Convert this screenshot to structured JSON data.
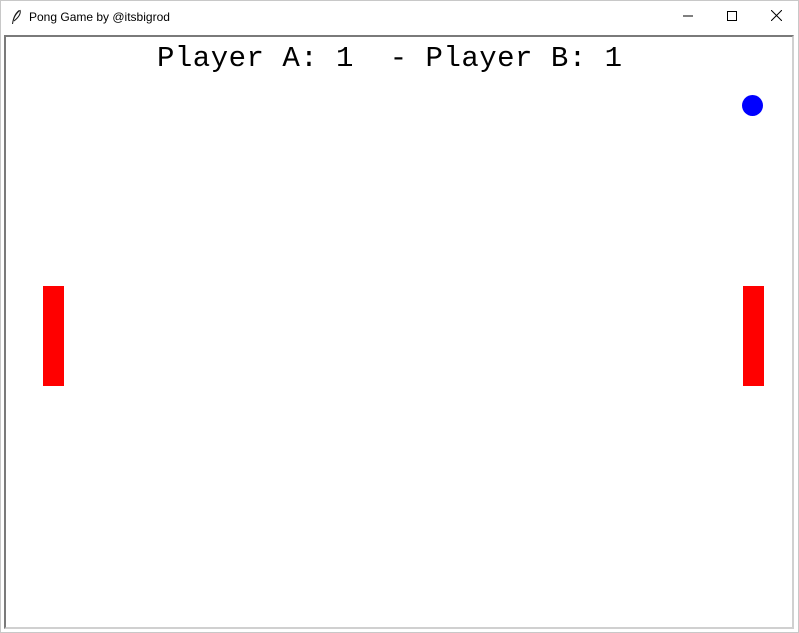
{
  "window": {
    "title": "Pong Game by @itsbigrod",
    "icon": "feather-icon"
  },
  "controls": {
    "minimize_icon": "minimize-icon",
    "maximize_icon": "maximize-icon",
    "close_icon": "close-icon"
  },
  "game": {
    "score_text": "Player A: 1  - Player B: 1",
    "player_a_score": 1,
    "player_b_score": 1,
    "colors": {
      "background": "#ffffff",
      "paddle": "#ff0000",
      "ball": "#0000ff",
      "text": "#000000"
    }
  }
}
